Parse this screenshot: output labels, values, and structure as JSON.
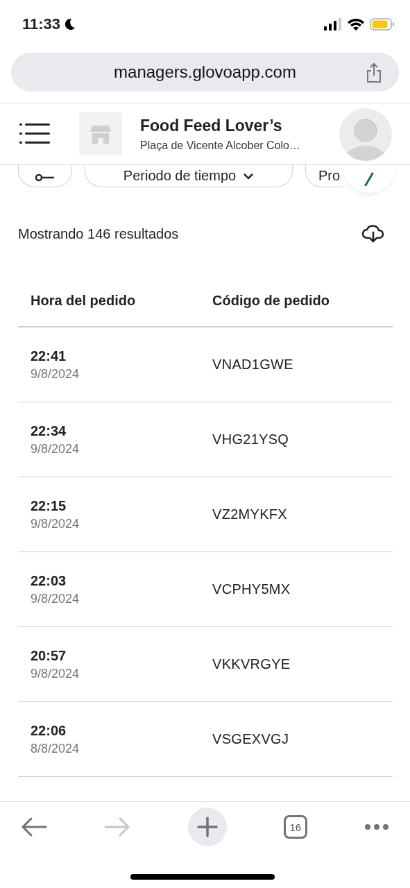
{
  "status_bar": {
    "time": "11:33"
  },
  "browser": {
    "url": "managers.glovoapp.com",
    "tab_count": "16",
    "forward_disabled": true
  },
  "header": {
    "store_name": "Food Feed Lover’s",
    "store_address": "Plaça de Vicente Alcober Colo…"
  },
  "filters": [
    {
      "kind": "icon"
    },
    {
      "kind": "dropdown",
      "label": "Periodo de tiempo"
    },
    {
      "kind": "text",
      "label": "Pro"
    }
  ],
  "results": {
    "summary": "Mostrando 146 resultados"
  },
  "table": {
    "columns": [
      "Hora del pedido",
      "Código de pedido"
    ],
    "rows": [
      {
        "time": "22:41",
        "date": "9/8/2024",
        "code": "VNAD1GWE"
      },
      {
        "time": "22:34",
        "date": "9/8/2024",
        "code": "VHG21YSQ"
      },
      {
        "time": "22:15",
        "date": "9/8/2024",
        "code": "VZ2MYKFX"
      },
      {
        "time": "22:03",
        "date": "9/8/2024",
        "code": "VCPHY5MX"
      },
      {
        "time": "20:57",
        "date": "9/8/2024",
        "code": "VKKVRGYE"
      },
      {
        "time": "22:06",
        "date": "8/8/2024",
        "code": "VSGEXVGJ"
      }
    ]
  }
}
